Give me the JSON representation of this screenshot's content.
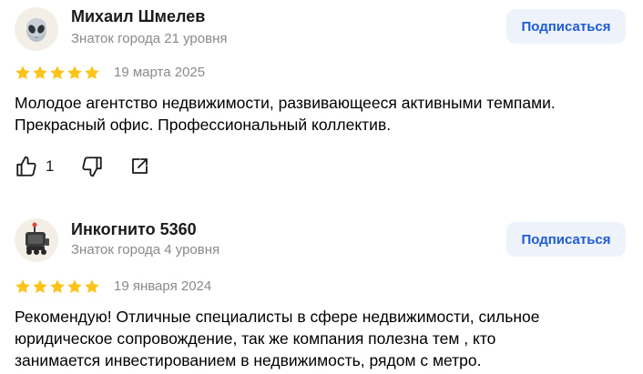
{
  "reviews": [
    {
      "author": {
        "name": "Михаил Шмелев",
        "level": "Знаток города 21 уровня",
        "avatar_icon": "alien-avatar-icon"
      },
      "subscribe_label": "Подписаться",
      "rating": 5,
      "date": "19 марта 2025",
      "text_lines": [
        "Молодое агентство недвижимости, развивающееся активными темпами.",
        "Прекрасный офис. Профессиональный коллектив."
      ],
      "likes": "1"
    },
    {
      "author": {
        "name": "Инкогнито 5360",
        "level": "Знаток города 4 уровня",
        "avatar_icon": "robot-avatar-icon"
      },
      "subscribe_label": "Подписаться",
      "rating": 5,
      "date": "19 января 2024",
      "text_lines": [
        "Рекомендую! Отличные специалисты в сфере недвижимости, сильное",
        "юридическое сопровождение, так же компания полезна тем , кто",
        "занимается инвестированием в недвижимость, рядом с метро."
      ]
    }
  ],
  "colors": {
    "star": "#fcc419",
    "subscribe_bg": "#eef3fb",
    "subscribe_text": "#1f5bd6",
    "muted": "#8a8a8a"
  }
}
